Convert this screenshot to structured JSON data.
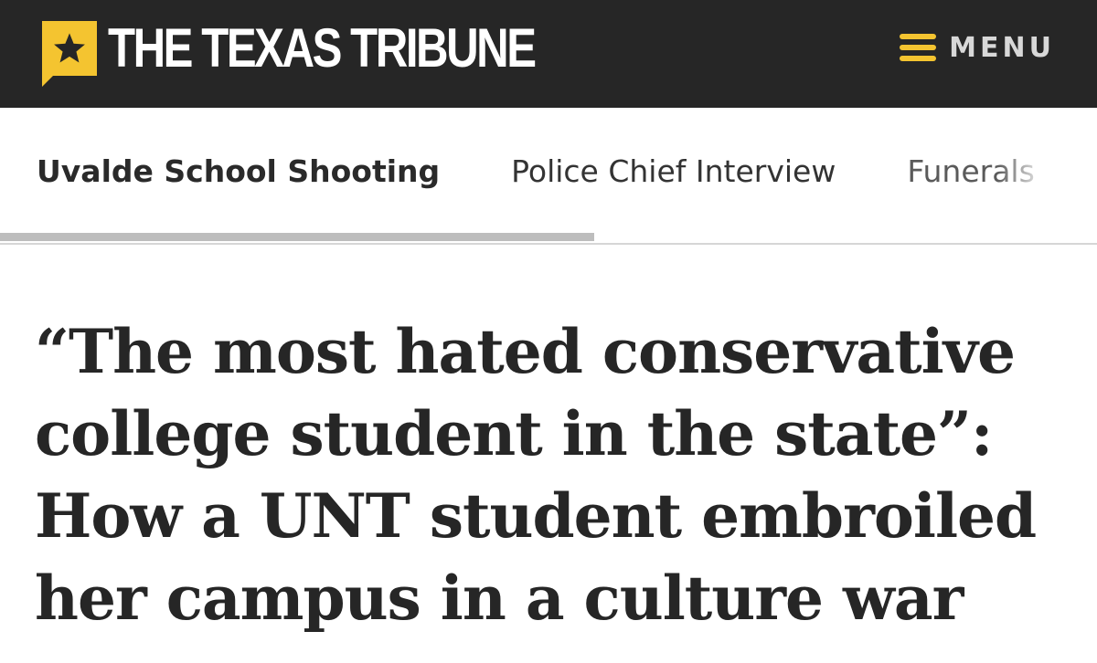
{
  "header": {
    "brand": "THE TEXAS TRIBUNE",
    "logo_icon": "star-icon",
    "menu_icon": "hamburger-icon",
    "menu_label": "MENU",
    "colors": {
      "bar_background": "#262626",
      "accent_yellow": "#f4c430"
    }
  },
  "subnav": {
    "items": [
      {
        "label": "Uvalde School Shooting",
        "active": true
      },
      {
        "label": "Police Chief Interview",
        "active": false
      },
      {
        "label": "Funerals",
        "active": false
      }
    ]
  },
  "article": {
    "headline_lines": [
      "“The most hated conservative",
      "college student in the state”:",
      "How a UNT student embroiled",
      "her campus in a culture war"
    ]
  }
}
